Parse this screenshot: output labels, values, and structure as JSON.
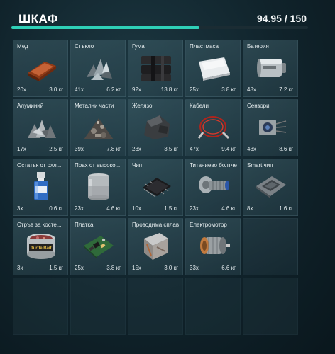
{
  "header": {
    "title": "ШКАФ",
    "weight": "94.95 / 150",
    "capacity_fraction": 0.633
  },
  "items": [
    {
      "name": "Мед",
      "qty": "20x",
      "weight": "3.0 кг",
      "icon": "copper-ingot-icon"
    },
    {
      "name": "Стъкло",
      "qty": "41x",
      "weight": "6.2 кг",
      "icon": "glass-shards-icon"
    },
    {
      "name": "Гума",
      "qty": "92x",
      "weight": "13.8 кг",
      "icon": "rubber-blocks-icon"
    },
    {
      "name": "Пластмаса",
      "qty": "25x",
      "weight": "3.8 кг",
      "icon": "plastic-sheet-icon"
    },
    {
      "name": "Батерия",
      "qty": "48x",
      "weight": "7.2 кг",
      "icon": "battery-icon"
    },
    {
      "name": "Алуминий",
      "qty": "17x",
      "weight": "2.5 кг",
      "icon": "aluminium-scrap-icon"
    },
    {
      "name": "Метални части",
      "qty": "39x",
      "weight": "7.8 кг",
      "icon": "metal-parts-icon"
    },
    {
      "name": "Желязо",
      "qty": "23x",
      "weight": "3.5 кг",
      "icon": "iron-ore-icon"
    },
    {
      "name": "Кабели",
      "qty": "47x",
      "weight": "9.4 кг",
      "icon": "cables-icon"
    },
    {
      "name": "Сензори",
      "qty": "43x",
      "weight": "8.6 кг",
      "icon": "sensor-icon"
    },
    {
      "name": "Остатък от охл...",
      "qty": "3x",
      "weight": "0.6 кг",
      "icon": "coolant-vial-icon"
    },
    {
      "name": "Прах от высоко...",
      "qty": "23x",
      "weight": "4.6 кг",
      "icon": "powder-jar-icon"
    },
    {
      "name": "Чип",
      "qty": "10x",
      "weight": "1.5 кг",
      "icon": "chip-icon"
    },
    {
      "name": "Титаниево болтче",
      "qty": "23x",
      "weight": "4.6 кг",
      "icon": "titanium-bolt-icon"
    },
    {
      "name": "Smart чип",
      "qty": "8x",
      "weight": "1.6 кг",
      "icon": "smart-chip-icon"
    },
    {
      "name": "Стръв за косте...",
      "qty": "3x",
      "weight": "1.5 кг",
      "icon": "bait-can-icon"
    },
    {
      "name": "Платка",
      "qty": "25x",
      "weight": "3.8 кг",
      "icon": "circuit-board-icon"
    },
    {
      "name": "Проводима сплав",
      "qty": "15x",
      "weight": "3.0 кг",
      "icon": "conductive-alloy-icon"
    },
    {
      "name": "Електромотор",
      "qty": "33x",
      "weight": "6.6 кг",
      "icon": "electric-motor-icon"
    }
  ],
  "bait_can_label": "Turtle Bait",
  "empty_slots": 6
}
